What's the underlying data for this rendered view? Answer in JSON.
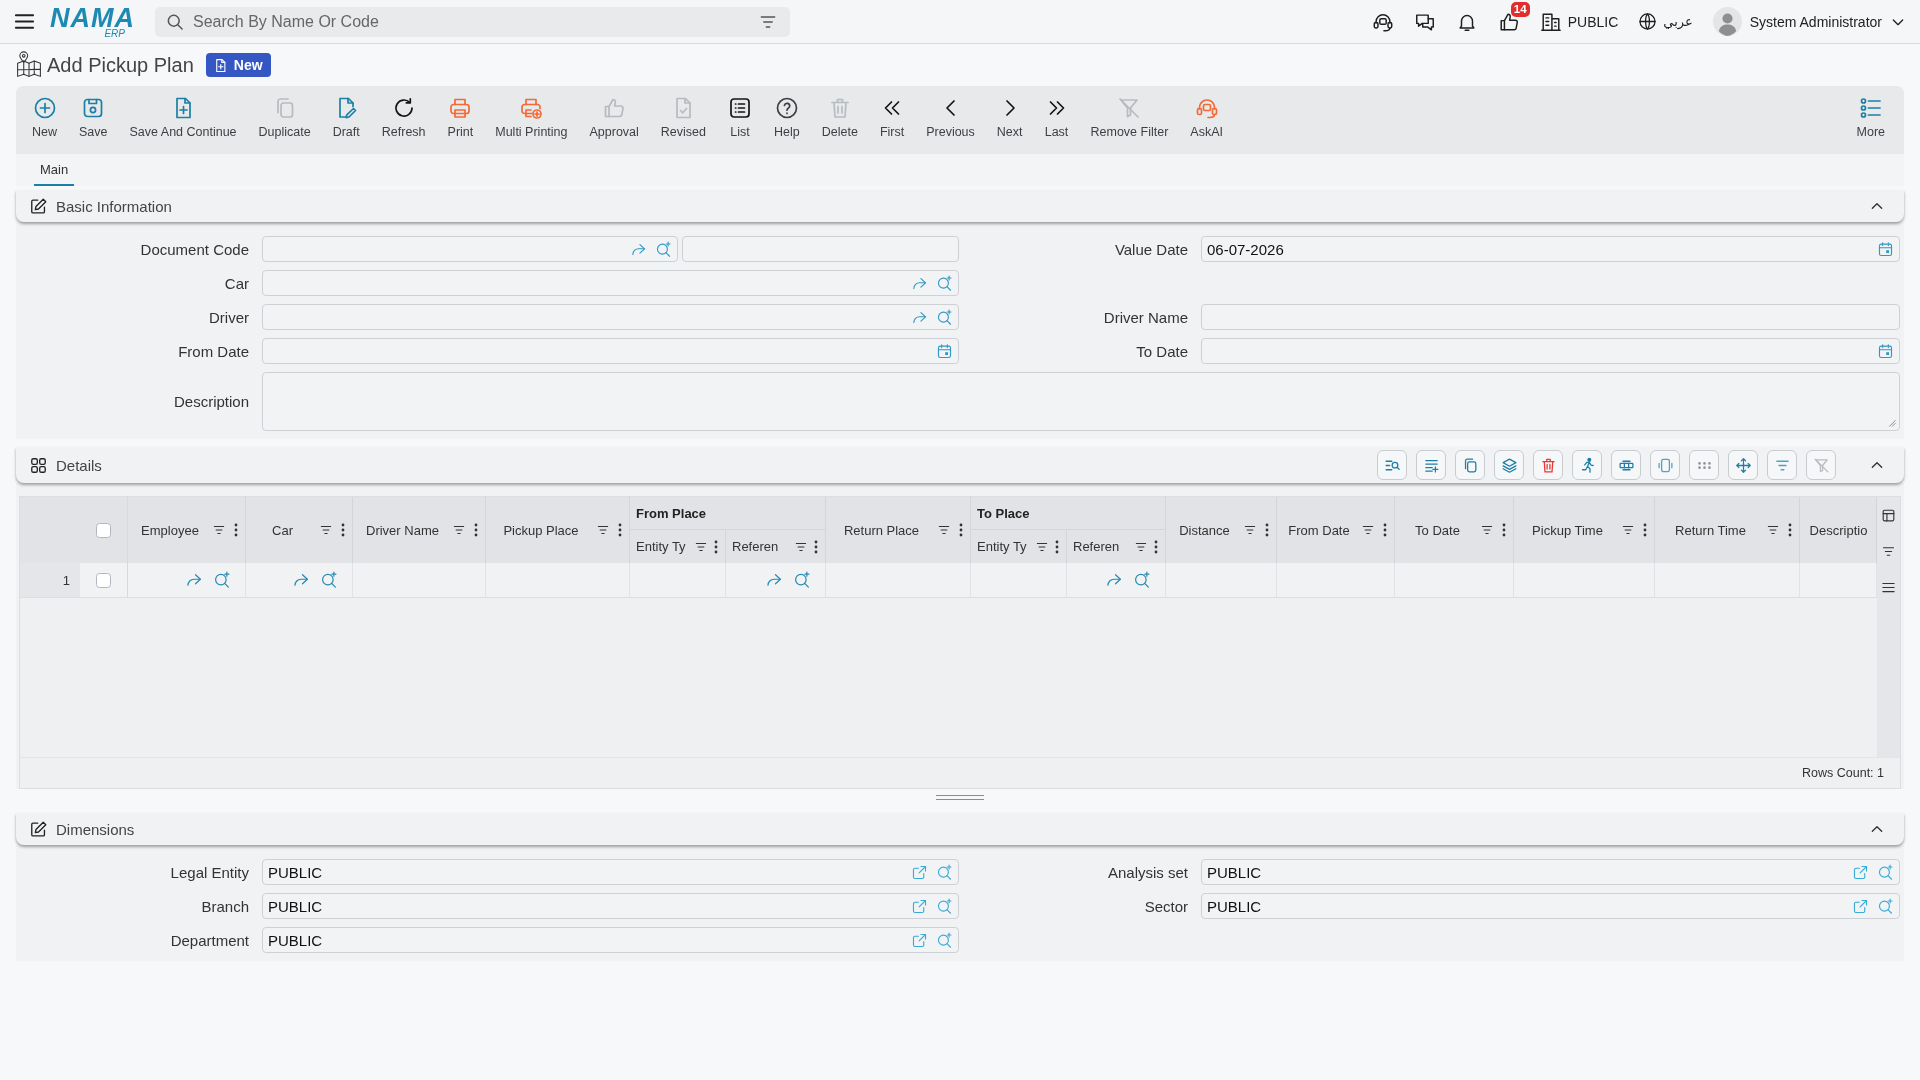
{
  "header": {
    "logo": {
      "name": "NAMA",
      "tag": "ERP"
    },
    "search": {
      "placeholder": "Search By Name Or Code"
    },
    "likes_badge": "14",
    "company": "PUBLIC",
    "language": "عربي",
    "user": "System Administrator"
  },
  "page": {
    "title": "Add Pickup Plan",
    "status": "New"
  },
  "toolbar": {
    "buttons": [
      {
        "label": "New",
        "disabled": false
      },
      {
        "label": "Save",
        "disabled": false
      },
      {
        "label": "Save And Continue",
        "disabled": false
      },
      {
        "label": "Duplicate",
        "disabled": true
      },
      {
        "label": "Draft",
        "disabled": false
      },
      {
        "label": "Refresh",
        "disabled": false
      },
      {
        "label": "Print",
        "disabled": false
      },
      {
        "label": "Multi Printing",
        "disabled": false
      },
      {
        "label": "Approval",
        "disabled": true
      },
      {
        "label": "Revised",
        "disabled": true
      },
      {
        "label": "List",
        "disabled": false
      },
      {
        "label": "Help",
        "disabled": false
      },
      {
        "label": "Delete",
        "disabled": true
      },
      {
        "label": "First",
        "disabled": false
      },
      {
        "label": "Previous",
        "disabled": false
      },
      {
        "label": "Next",
        "disabled": false
      },
      {
        "label": "Last",
        "disabled": false
      },
      {
        "label": "Remove Filter",
        "disabled": true
      },
      {
        "label": "AskAI",
        "disabled": false
      }
    ],
    "more": "More"
  },
  "tabs": [
    {
      "label": "Main",
      "selected": true
    }
  ],
  "sections": [
    {
      "kind": "form",
      "title": "Basic Information",
      "expanded": true,
      "rows": [
        {
          "fields": [
            {
              "label": "Document Code",
              "kind": "code"
            },
            {
              "label": "Value Date",
              "kind": "date",
              "value": "06-07-2026"
            }
          ]
        },
        {
          "fields": [
            {
              "label": "Car",
              "kind": "lookup"
            }
          ]
        },
        {
          "fields": [
            {
              "label": "Driver",
              "kind": "lookup"
            },
            {
              "label": "Driver Name",
              "kind": "text"
            }
          ]
        },
        {
          "fields": [
            {
              "label": "From Date",
              "kind": "date"
            },
            {
              "label": "To Date",
              "kind": "date"
            }
          ]
        },
        {
          "fields": [
            {
              "label": "Description",
              "kind": "textarea"
            }
          ]
        }
      ]
    },
    {
      "kind": "grid",
      "title": "Details",
      "expanded": true,
      "tools": [
        {
          "disabled": false
        },
        {
          "disabled": false
        },
        {
          "disabled": false
        },
        {
          "disabled": false
        },
        {
          "disabled": false
        },
        {
          "disabled": false
        },
        {
          "disabled": false
        },
        {
          "disabled": false
        },
        {
          "disabled": false
        },
        {
          "disabled": false
        },
        {
          "disabled": false
        },
        {
          "disabled": true
        }
      ],
      "grid": {
        "all_selected": false,
        "columns": [
          {
            "label": "Employee",
            "kind": "lookup"
          },
          {
            "label": "Car",
            "kind": "lookup"
          },
          {
            "label": "Driver Name",
            "kind": "text"
          },
          {
            "label": "Pickup Place",
            "kind": "text"
          },
          {
            "label": "From Place",
            "children": [
              {
                "label": "Entity Ty",
                "kind": "text"
              },
              {
                "label": "Referen",
                "kind": "lookup"
              }
            ]
          },
          {
            "label": "Return Place",
            "kind": "text"
          },
          {
            "label": "To Place",
            "children": [
              {
                "label": "Entity Ty",
                "kind": "text"
              },
              {
                "label": "Referen",
                "kind": "lookup"
              }
            ]
          },
          {
            "label": "Distance",
            "kind": "text"
          },
          {
            "label": "From Date",
            "kind": "text"
          },
          {
            "label": "To Date",
            "kind": "text"
          },
          {
            "label": "Pickup Time",
            "kind": "text"
          },
          {
            "label": "Return Time",
            "kind": "text"
          },
          {
            "label": "Descriptio",
            "kind": "text"
          }
        ],
        "rows": [
          {
            "number": "1",
            "selected": false
          }
        ],
        "rows_count": "Rows Count: 1"
      }
    },
    {
      "kind": "form",
      "title": "Dimensions",
      "expanded": true,
      "rows": [
        {
          "fields": [
            {
              "label": "Legal Entity",
              "kind": "link",
              "value": "PUBLIC"
            },
            {
              "label": "Analysis set",
              "kind": "link",
              "value": "PUBLIC"
            }
          ]
        },
        {
          "fields": [
            {
              "label": "Branch",
              "kind": "link",
              "value": "PUBLIC"
            },
            {
              "label": "Sector",
              "kind": "link",
              "value": "PUBLIC"
            }
          ]
        },
        {
          "fields": [
            {
              "label": "Department",
              "kind": "link",
              "value": "PUBLIC"
            }
          ]
        }
      ]
    }
  ]
}
